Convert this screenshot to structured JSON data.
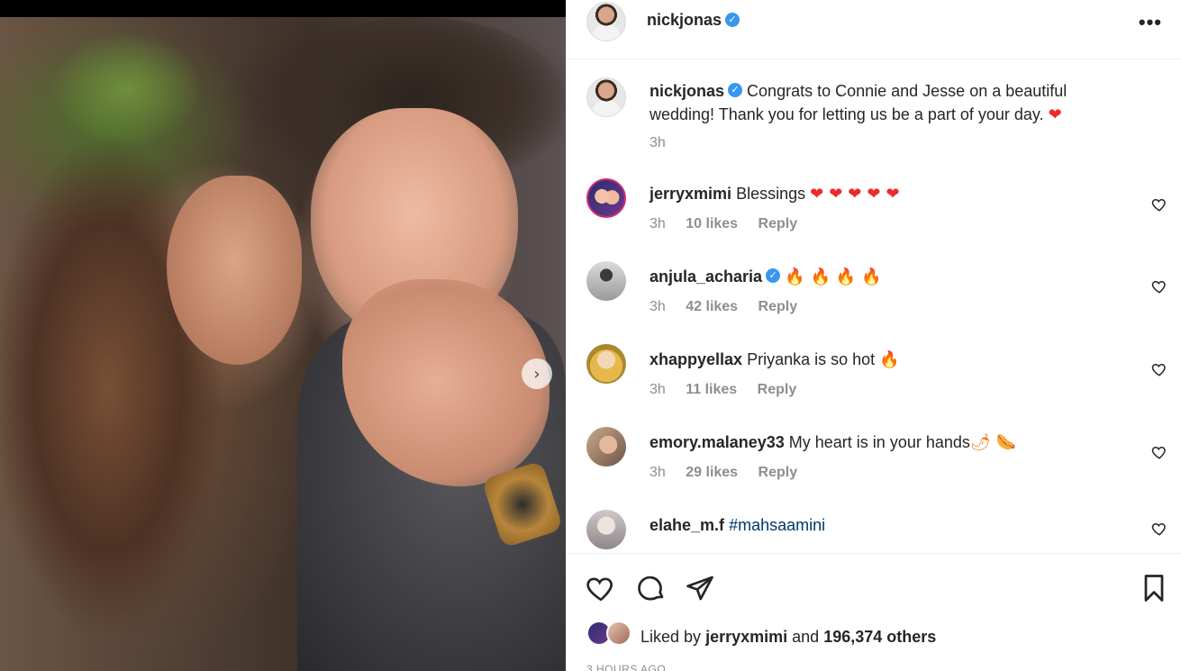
{
  "post": {
    "author": "nickjonas",
    "caption": "Congrats to Connie and Jesse on a beautiful wedding! Thank you for letting us be a part of your day.",
    "caption_emoji": "❤",
    "caption_time": "3h",
    "more_icon": "•••",
    "carousel_next_icon": "›"
  },
  "comments": [
    {
      "user": "jerryxmimi",
      "text": "Blessings",
      "emoji": "❤❤❤❤❤",
      "time": "3h",
      "likes": "10 likes",
      "reply": "Reply",
      "verified": false
    },
    {
      "user": "anjula_acharia",
      "text": "",
      "emoji": "🔥🔥🔥🔥",
      "time": "3h",
      "likes": "42 likes",
      "reply": "Reply",
      "verified": true
    },
    {
      "user": "xhappyellax",
      "text": "Priyanka is so hot",
      "emoji": "🔥",
      "time": "3h",
      "likes": "11 likes",
      "reply": "Reply",
      "verified": false
    },
    {
      "user": "emory.malaney33",
      "text": "My heart is in your hands",
      "emoji": "🌶🌭",
      "time": "3h",
      "likes": "29 likes",
      "reply": "Reply",
      "verified": false
    },
    {
      "user": "elahe_m.f",
      "text": "#mahsaamini",
      "emoji": "",
      "time": "",
      "likes": "",
      "reply": "",
      "verified": false
    }
  ],
  "likes": {
    "prefix": "Liked by",
    "user": "jerryxmimi",
    "middle": "and",
    "count": "196,374 others"
  },
  "timestamp": "3 HOURS AGO",
  "verified_glyph": "✓",
  "colors": {
    "verified": "#3897f0",
    "heart": "#ed2a2a",
    "fire": "#f07a14",
    "meta": "#8e8e8e",
    "link": "#00376b"
  }
}
